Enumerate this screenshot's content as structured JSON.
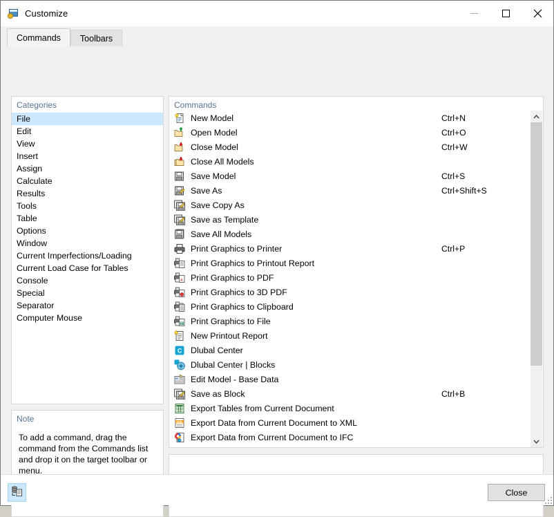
{
  "window": {
    "title": "Customize",
    "icon": "customize-window-icon",
    "controls": {
      "minimize": "–",
      "maximize": "□",
      "close": "✕"
    }
  },
  "tabs": [
    {
      "label": "Commands",
      "active": true
    },
    {
      "label": "Toolbars",
      "active": false
    }
  ],
  "categories": {
    "label": "Categories",
    "selected": "File",
    "items": [
      "File",
      "Edit",
      "View",
      "Insert",
      "Assign",
      "Calculate",
      "Results",
      "Tools",
      "Table",
      "Options",
      "Window",
      "Current Imperfections/Loading",
      "Current Load Case for Tables",
      "Console",
      "Special",
      "Separator",
      "Computer Mouse"
    ]
  },
  "note": {
    "label": "Note",
    "text": "To add a command, drag the command from the Commands list and drop it on the target toolbar or menu."
  },
  "commands": {
    "label": "Commands",
    "items": [
      {
        "icon": "new-model-icon",
        "label": "New Model",
        "shortcut": "Ctrl+N"
      },
      {
        "icon": "open-model-folder-icon",
        "label": "Open Model",
        "shortcut": "Ctrl+O"
      },
      {
        "icon": "close-model-folder-icon",
        "label": "Close Model",
        "shortcut": "Ctrl+W"
      },
      {
        "icon": "close-all-models-icon",
        "label": "Close All Models",
        "shortcut": ""
      },
      {
        "icon": "save-model-floppy-icon",
        "label": "Save Model",
        "shortcut": "Ctrl+S"
      },
      {
        "icon": "save-as-floppy-pencil-icon",
        "label": "Save As",
        "shortcut": "Ctrl+Shift+S"
      },
      {
        "icon": "save-copy-as-icon",
        "label": "Save Copy As",
        "shortcut": ""
      },
      {
        "icon": "save-as-template-icon",
        "label": "Save as Template",
        "shortcut": ""
      },
      {
        "icon": "save-all-models-icon",
        "label": "Save All Models",
        "shortcut": ""
      },
      {
        "icon": "print-to-printer-icon",
        "label": "Print Graphics to Printer",
        "shortcut": "Ctrl+P"
      },
      {
        "icon": "print-to-printout-report-icon",
        "label": "Print Graphics to Printout Report",
        "shortcut": ""
      },
      {
        "icon": "print-to-pdf-icon",
        "label": "Print Graphics to PDF",
        "shortcut": ""
      },
      {
        "icon": "print-to-3d-pdf-icon",
        "label": "Print Graphics to 3D PDF",
        "shortcut": ""
      },
      {
        "icon": "print-to-clipboard-icon",
        "label": "Print Graphics to Clipboard",
        "shortcut": ""
      },
      {
        "icon": "print-to-file-icon",
        "label": "Print Graphics to File",
        "shortcut": ""
      },
      {
        "icon": "new-printout-report-icon",
        "label": "New Printout Report",
        "shortcut": ""
      },
      {
        "icon": "dlubal-center-icon",
        "label": "Dlubal Center",
        "shortcut": ""
      },
      {
        "icon": "dlubal-center-blocks-icon",
        "label": "Dlubal Center | Blocks",
        "shortcut": ""
      },
      {
        "icon": "edit-model-base-data-icon",
        "label": "Edit Model - Base Data",
        "shortcut": ""
      },
      {
        "icon": "save-as-block-icon",
        "label": "Save as Block",
        "shortcut": "Ctrl+B"
      },
      {
        "icon": "export-tables-excel-icon",
        "label": "Export Tables from Current Document",
        "shortcut": ""
      },
      {
        "icon": "export-xml-icon",
        "label": "Export Data from Current Document to XML",
        "shortcut": ""
      },
      {
        "icon": "export-ifc-icon",
        "label": "Export Data from Current Document to IFC",
        "shortcut": ""
      }
    ]
  },
  "description": {
    "text": ""
  },
  "footer": {
    "toolbar_icon": "command-stack-icon",
    "close_label": "Close"
  },
  "scrollbar": {
    "up_arrow": "chevron-up-icon",
    "down_arrow": "chevron-down-icon"
  },
  "colors": {
    "selection": "#cce8ff",
    "group_label": "#5a7391",
    "dialog_bg": "#f0f0f0",
    "panel_bg": "#ffffff"
  }
}
